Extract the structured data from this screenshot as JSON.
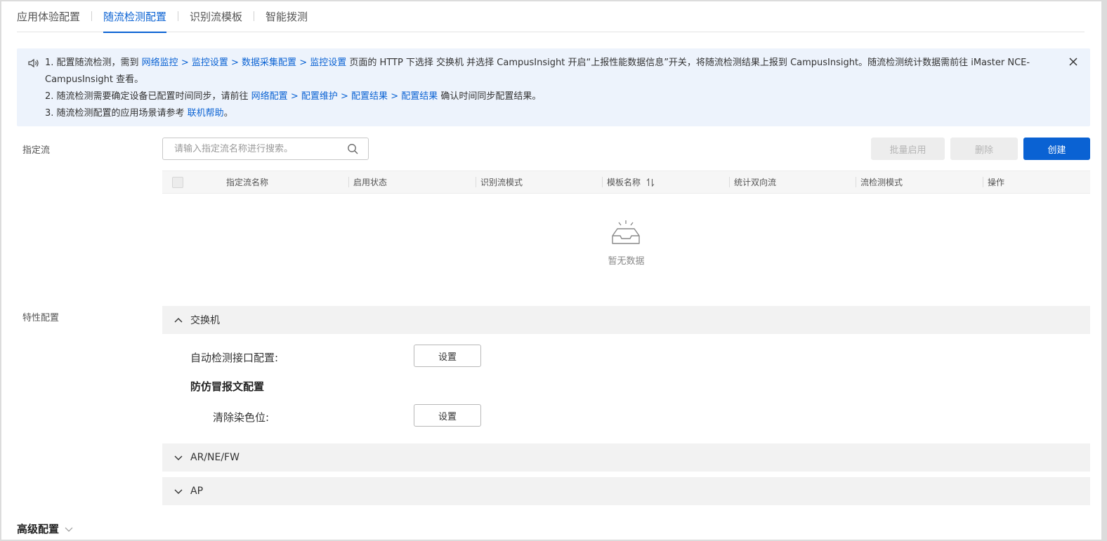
{
  "tabs": [
    {
      "label": "应用体验配置",
      "active": false
    },
    {
      "label": "随流检测配置",
      "active": true
    },
    {
      "label": "识别流模板",
      "active": false
    },
    {
      "label": "智能拨测",
      "active": false
    }
  ],
  "notice": {
    "line1_prefix": "1. 配置随流检测，需到 ",
    "line1_link1": "网络监控",
    "line1_sep1": " > ",
    "line1_link2": "监控设置",
    "line1_sep2": " > ",
    "line1_link3": "数据采集配置",
    "line1_sep3": " > ",
    "line1_link4": "监控设置",
    "line1_mid": " 页面的 HTTP 下选择 交换机 并选择 CampusInsight 开启“上报性能数据信息”开关，将随流检测结果上报到 CampusInsight。随流检测统计数据需前往 iMaster NCE-CampusInsight 查看。",
    "line2_prefix": "2. 随流检测需要确定设备已配置时间同步，请前往 ",
    "line2_link1": "网络配置",
    "line2_sep1": " > ",
    "line2_link2": "配置维护",
    "line2_sep2": " > ",
    "line2_link3": "配置结果",
    "line2_sep3": " > ",
    "line2_link4": "配置结果",
    "line2_suffix": " 确认时间同步配置结果。",
    "line3_prefix": "3. 随流检测配置的应用场景请参考 ",
    "line3_link": "联机帮助",
    "line3_suffix": "。"
  },
  "designated_flow": {
    "label": "指定流",
    "search_placeholder": "请输入指定流名称进行搜索。",
    "batch_enable": "批量启用",
    "delete": "删除",
    "create": "创建",
    "columns": [
      "指定流名称",
      "启用状态",
      "识别流模式",
      "模板名称",
      "统计双向流",
      "流检测模式",
      "操作"
    ],
    "empty_text": "暂无数据"
  },
  "feature_config": {
    "label": "特性配置",
    "switch_section": "交换机",
    "auto_detect_label": "自动检测接口配置:",
    "set_label": "设置",
    "anti_spoof_heading": "防仿冒报文配置",
    "clear_color_label": "清除染色位:",
    "ar_section": "AR/NE/FW",
    "ap_section": "AP"
  },
  "advanced": {
    "label": "高级配置"
  },
  "colors": {
    "accent": "#0a62d3",
    "notice_bg": "#edf3fc"
  }
}
